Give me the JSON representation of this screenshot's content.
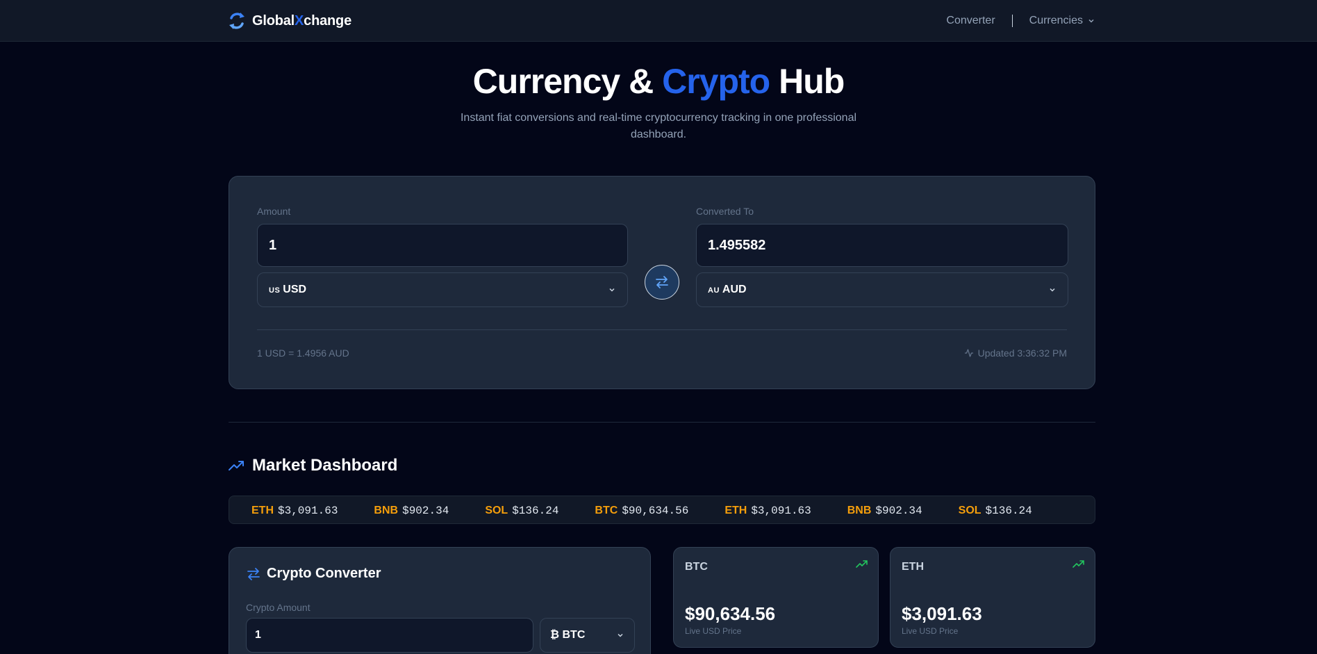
{
  "brand": {
    "name_prefix": "Global",
    "name_x": "X",
    "name_suffix": "change"
  },
  "nav": {
    "converter": "Converter",
    "currencies": "Currencies"
  },
  "hero": {
    "title_part1": "Currency & ",
    "title_accent": "Crypto",
    "title_part2": " Hub",
    "subtitle": "Instant fiat conversions and real-time cryptocurrency tracking in one professional dashboard."
  },
  "converter": {
    "amount_label": "Amount",
    "amount_value": "1",
    "from_flag": "US",
    "from_currency": "USD",
    "to_label": "Converted To",
    "to_value": "1.495582",
    "to_flag": "AU",
    "to_currency": "AUD",
    "rate_text": "1 USD = 1.4956 AUD",
    "updated_text": "Updated 3:36:32 PM"
  },
  "dashboard": {
    "title": "Market Dashboard",
    "ticker": [
      {
        "symbol": "ETH",
        "price": "$3,091.63"
      },
      {
        "symbol": "BNB",
        "price": "$902.34"
      },
      {
        "symbol": "SOL",
        "price": "$136.24"
      },
      {
        "symbol": "BTC",
        "price": "$90,634.56"
      },
      {
        "symbol": "ETH",
        "price": "$3,091.63"
      },
      {
        "symbol": "BNB",
        "price": "$902.34"
      },
      {
        "symbol": "SOL",
        "price": "$136.24"
      }
    ]
  },
  "crypto_converter": {
    "title": "Crypto Converter",
    "amount_label": "Crypto Amount",
    "amount_value": "1",
    "coin_icon": "₿",
    "coin": "BTC"
  },
  "price_cards": [
    {
      "symbol": "BTC",
      "price": "$90,634.56",
      "note": "Live USD Price"
    },
    {
      "symbol": "ETH",
      "price": "$3,091.63",
      "note": "Live USD Price"
    }
  ],
  "colors": {
    "accent": "#2563eb",
    "background": "#030618",
    "card": "#1e293b",
    "ticker_symbol": "#f59e0b",
    "trend_up": "#22c55e"
  }
}
